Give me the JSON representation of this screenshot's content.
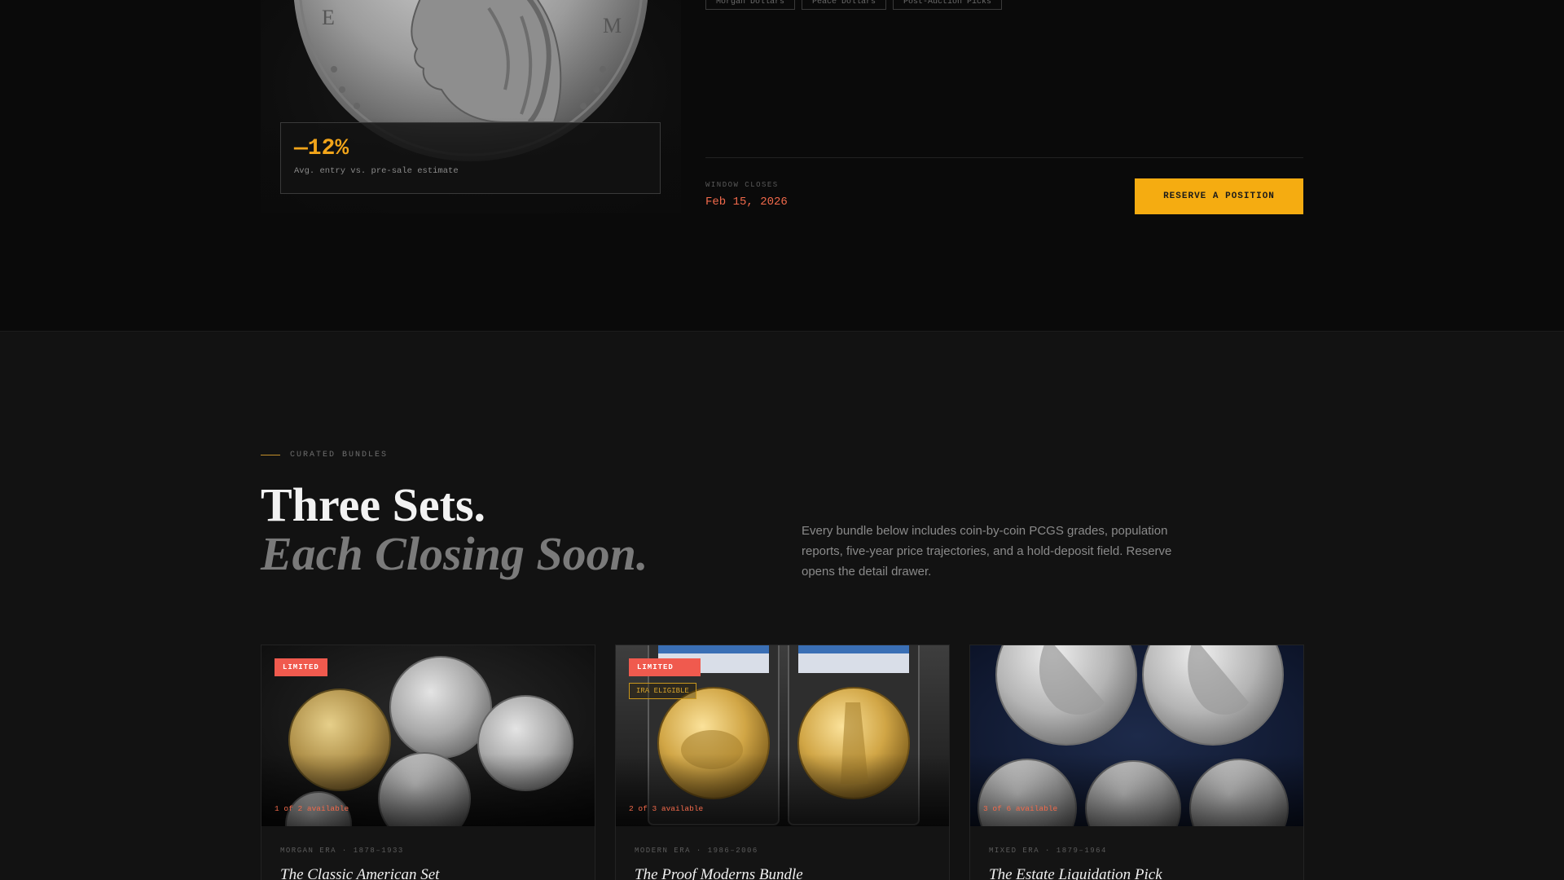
{
  "featured": {
    "tags": [
      "Morgan Dollars",
      "Peace Dollars",
      "Post-Auction Picks"
    ],
    "stat": {
      "value": "—12%",
      "caption": "Avg. entry vs. pre-sale estimate"
    },
    "window_label": "WINDOW CLOSES",
    "window_date": "Feb 15, 2026",
    "reserve_label": "RESERVE A POSITION",
    "colors": {
      "accent": "#f5ac11",
      "date": "#f26a4b",
      "stat": "#f2a51a"
    }
  },
  "curated": {
    "eyebrow": "CURATED BUNDLES",
    "headline_line1": "Three Sets.",
    "headline_line2": "Each Closing Soon.",
    "intro": "Every bundle below includes coin-by-coin PCGS grades, population reports, five-year price trajectories, and a hold-deposit field. Reserve opens the detail drawer.",
    "cards": [
      {
        "badge": "LIMITED",
        "availability": "1 of 2 available",
        "meta": "MORGAN ERA · 1878–1933",
        "title": "The Classic American Set",
        "image": "silver-and-gold-coin-group"
      },
      {
        "badge": "LIMITED",
        "secondary_badge": "IRA ELIGIBLE",
        "availability": "2 of 3 available",
        "meta": "MODERN ERA · 1986–2006",
        "title": "The Proof Moderns Bundle",
        "image": "slabbed-gold-proofs"
      },
      {
        "badge": "",
        "availability": "3 of 6 available",
        "meta": "MIXED ERA · 1879–1964",
        "title": "The Estate Liquidation Pick",
        "image": "silver-dollar-layout"
      }
    ],
    "colors": {
      "badge": "#f05a4e",
      "availability": "#f26a4b",
      "eyebrow_line": "#c4902b"
    }
  }
}
